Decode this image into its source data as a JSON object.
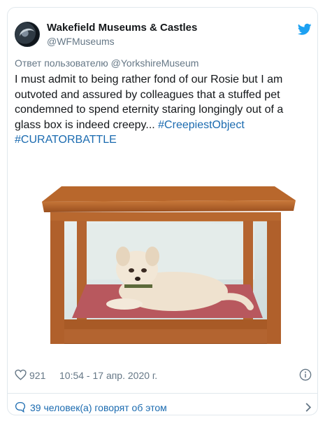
{
  "author": {
    "display_name": "Wakefield Museums & Castles",
    "handle": "@WFMuseums"
  },
  "reply_context": "Ответ пользователю @YorkshireMuseum",
  "tweet": {
    "text": "I must admit to being rather fond of our Rosie but I am outvoted and assured by colleagues that a stuffed pet condemned to spend eternity staring longingly out of a glass box is indeed creepy...",
    "hashtags": [
      "#CreepiestObject",
      "#CURATORBATTLE"
    ]
  },
  "media": {
    "icon": "stuffed-dog-display-case-photo"
  },
  "meta": {
    "likes": "921",
    "timestamp": "10:54 - 17 апр. 2020 г."
  },
  "footer": {
    "discussion": "39 человек(а) говорят об этом"
  },
  "colors": {
    "link": "#1b6bb0",
    "twitter_blue": "#1da1f2",
    "muted": "#657786",
    "border": "#e1e8ed"
  }
}
